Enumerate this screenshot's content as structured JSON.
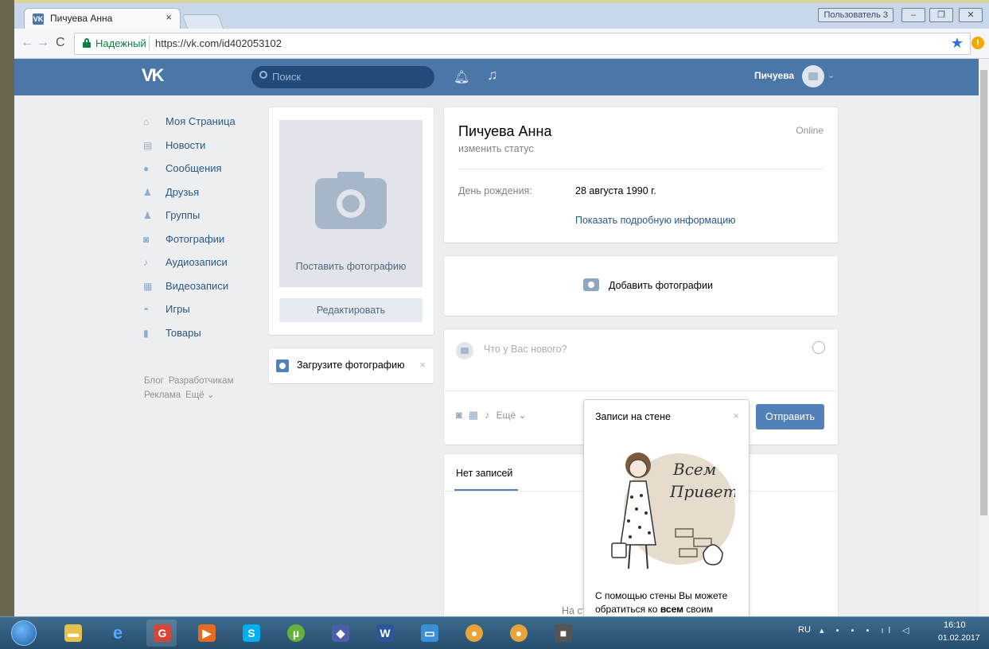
{
  "browser": {
    "tab_title": "Пичуева Анна",
    "tab_close": "×",
    "user_badge": "Пользователь 3",
    "win_minimize": "–",
    "win_maximize": "❐",
    "win_close": "✕",
    "secure_label": "Надежный",
    "url": "https://vk.com/id402053102"
  },
  "vk_header": {
    "logo": "VK",
    "search_placeholder": "Поиск",
    "username": "Пичуева"
  },
  "left_nav": {
    "items": [
      {
        "label": "Моя Страница",
        "icon": "home-icon"
      },
      {
        "label": "Новости",
        "icon": "news-icon"
      },
      {
        "label": "Сообщения",
        "icon": "messages-icon"
      },
      {
        "label": "Друзья",
        "icon": "friends-icon"
      },
      {
        "label": "Группы",
        "icon": "groups-icon"
      },
      {
        "label": "Фотографии",
        "icon": "photos-icon"
      },
      {
        "label": "Аудиозаписи",
        "icon": "audio-icon"
      },
      {
        "label": "Видеозаписи",
        "icon": "video-icon"
      },
      {
        "label": "Игры",
        "icon": "games-icon"
      },
      {
        "label": "Товары",
        "icon": "goods-icon"
      }
    ],
    "footer_links": [
      "Блог",
      "Разработчикам",
      "Реклама",
      "Ещё ⌄"
    ]
  },
  "photo_card": {
    "set_photo": "Поставить фотографию",
    "edit": "Редактировать"
  },
  "upload_card": {
    "text": "Загрузите фотографию",
    "close": "×"
  },
  "profile": {
    "name": "Пичуева Анна",
    "change_status": "изменить статус",
    "online": "Online",
    "birthday_label": "День рождения:",
    "birthday_value": "28 августа 1990 г.",
    "show_details": "Показать подробную информацию"
  },
  "add_photos": {
    "label": "Добавить фотографии"
  },
  "post_box": {
    "placeholder": "Что у Вас нового?",
    "more": "Ещё ⌄",
    "send": "Отправить"
  },
  "wall": {
    "tab": "Нет записей",
    "empty_partial": "На ст"
  },
  "popup": {
    "title": "Записи на стене",
    "close": "×",
    "text_before": "С помощью стены Вы можете обратиться ко ",
    "text_bold": "всем",
    "text_after": " своим",
    "illustration_text_1": "Всем",
    "illustration_text_2": "Привет!"
  },
  "taskbar": {
    "lang": "RU",
    "time": "16:10",
    "date": "01.02.2017"
  },
  "colors": {
    "vk_blue": "#4a76a8",
    "vk_button": "#5181b8",
    "page_bg": "#edeef0"
  }
}
